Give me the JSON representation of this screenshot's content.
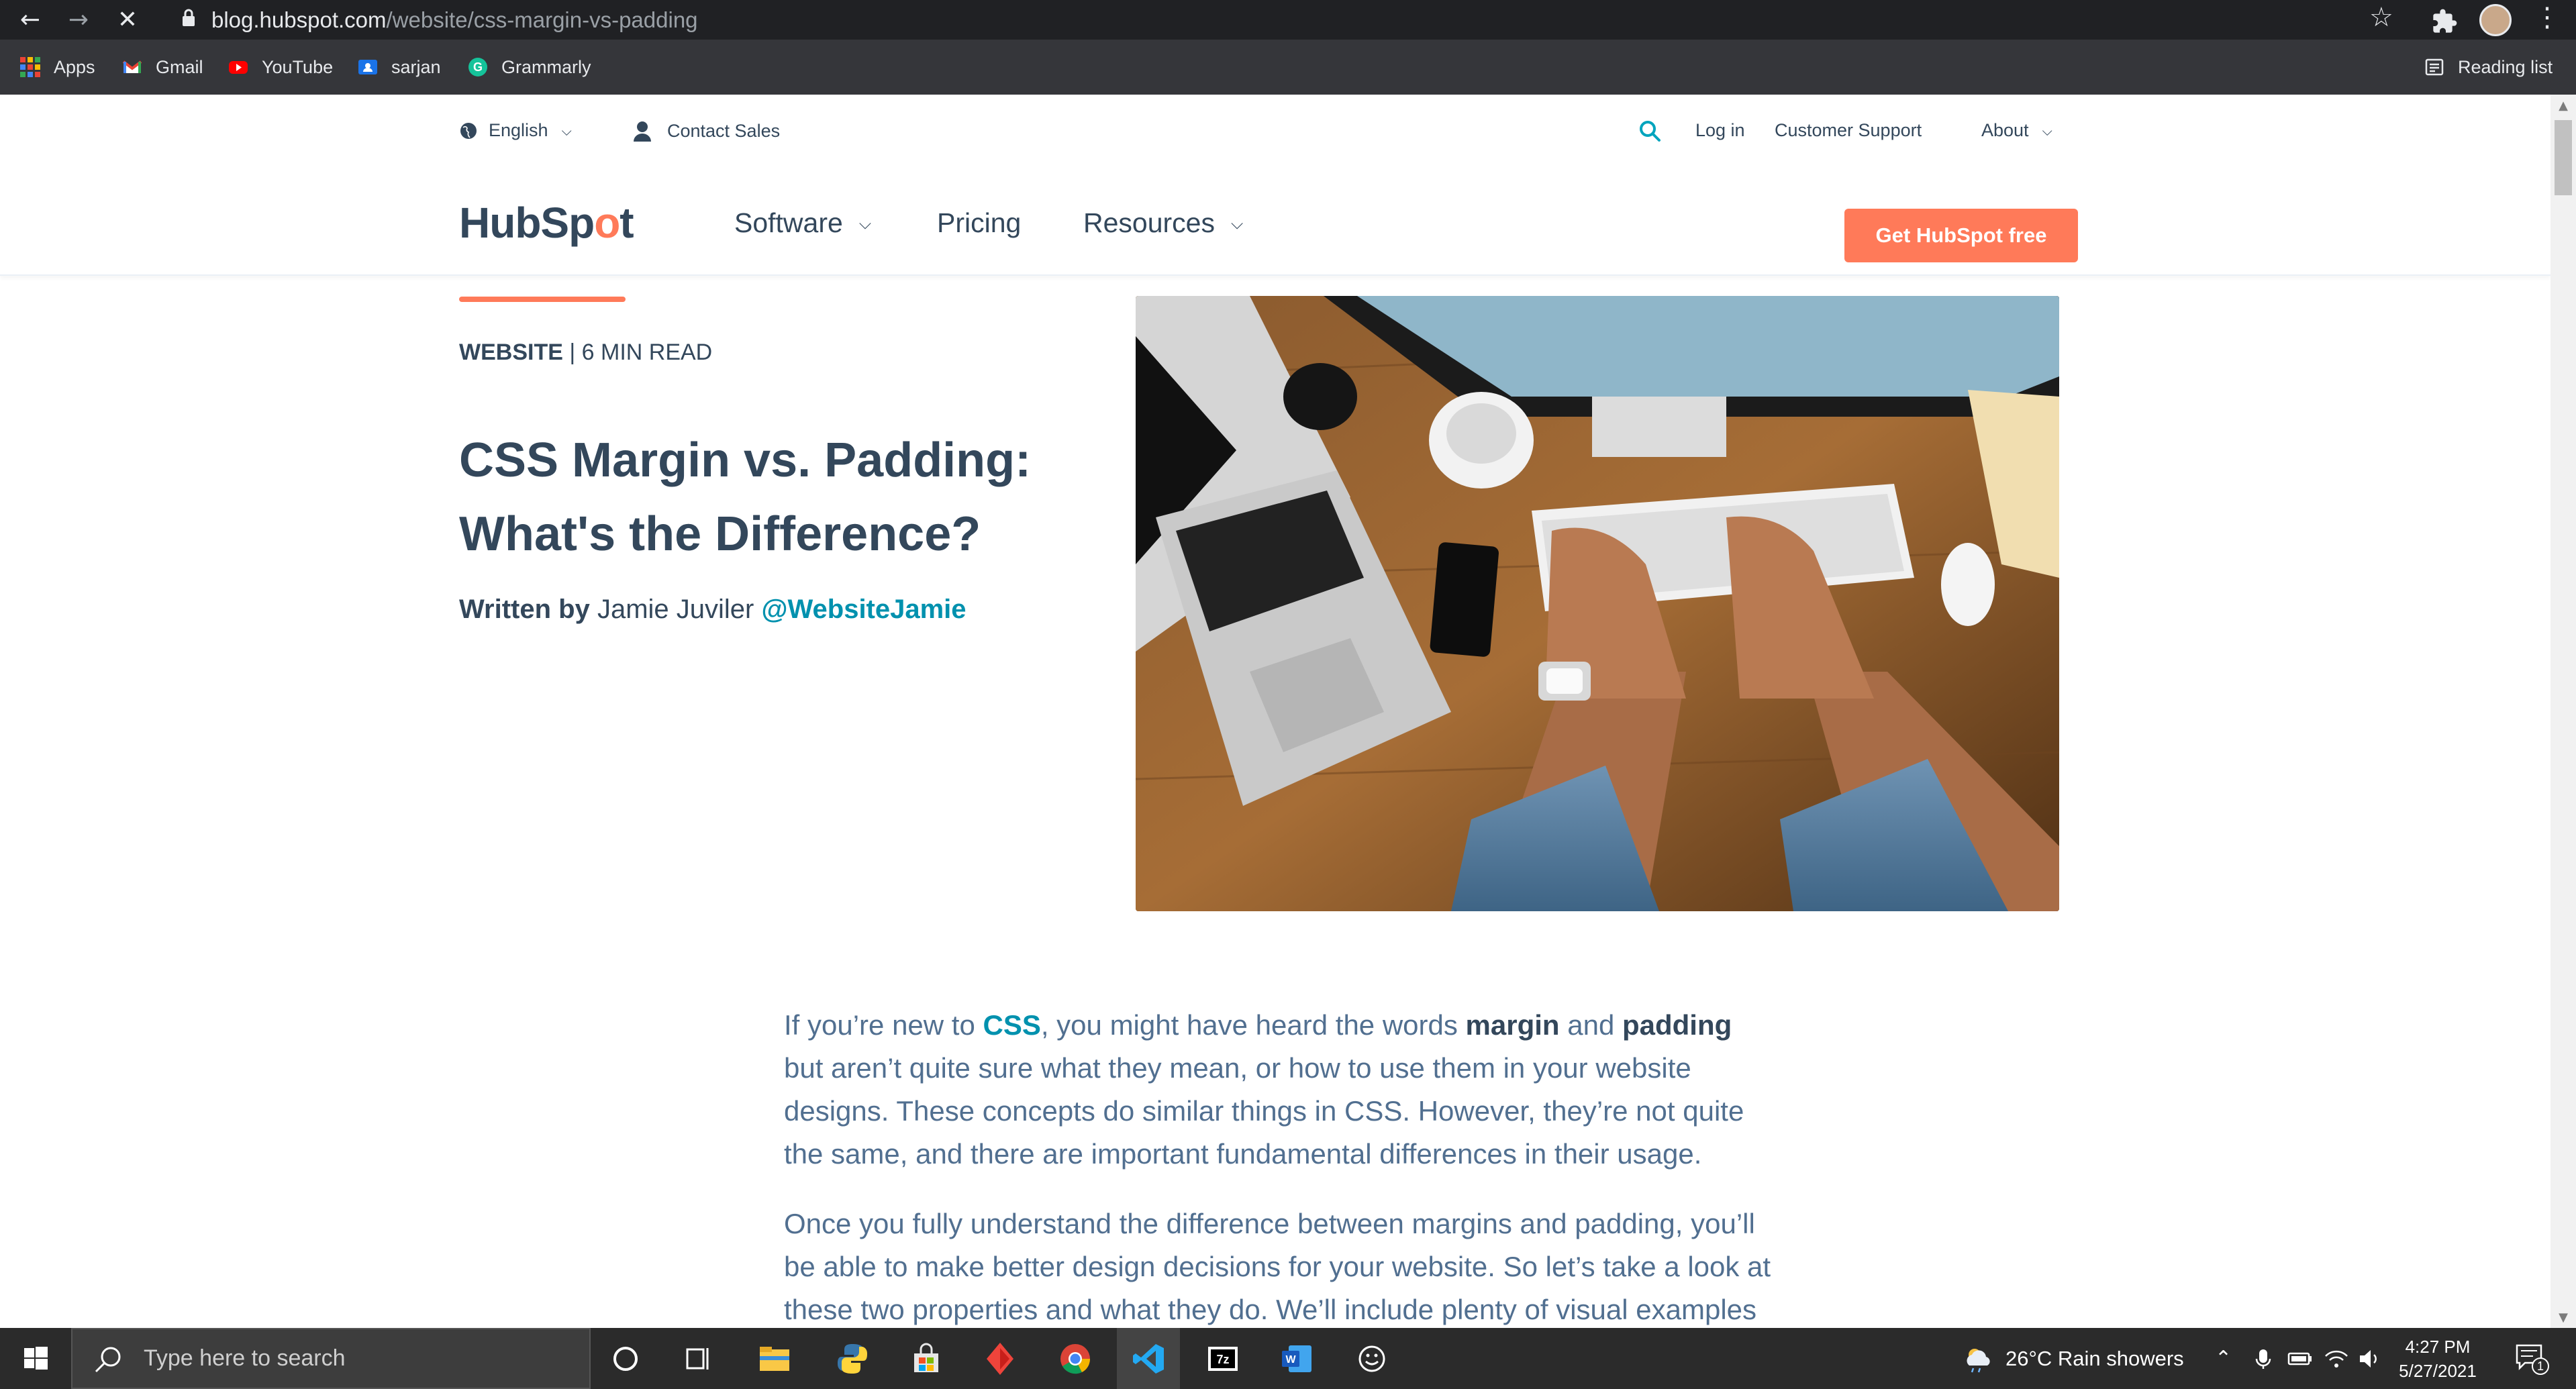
{
  "browser": {
    "url_host": "blog.hubspot.com",
    "url_path": "/website/css-margin-vs-padding",
    "bookmarks": [
      "Apps",
      "Gmail",
      "YouTube",
      "sarjan",
      "Grammarly"
    ],
    "reading_list": "Reading list"
  },
  "utility_nav": {
    "language": "English",
    "contact_sales": "Contact Sales",
    "log_in": "Log in",
    "customer_support": "Customer Support",
    "about": "About"
  },
  "main_nav": {
    "logo_pre": "HubSp",
    "logo_o": "o",
    "logo_post": "t",
    "items": [
      "Software",
      "Pricing",
      "Resources"
    ],
    "cta": "Get HubSpot free"
  },
  "article": {
    "category": "WEBSITE",
    "read_time": "| 6 MIN READ",
    "title": "CSS Margin vs. Padding: What's the Difference?",
    "written_by": "Written by",
    "author": "Jamie Juviler",
    "handle": "@WebsiteJamie",
    "p1_a": "If you’re new to ",
    "p1_link": "CSS",
    "p1_b": ", you might have heard the words ",
    "p1_margin": "margin",
    "p1_c": " and ",
    "p1_padding": "padding",
    "p1_d": " but aren’t quite sure what they mean, or how to use them in your website designs. These concepts do similar things in CSS. However, they’re not quite the same, and there are important fundamental differences in their usage.",
    "p2": "Once you fully understand the difference between margins and padding, you’ll be able to make better design decisions for your website. So let’s take a look at these two properties and what they do. We’ll include plenty of visual examples"
  },
  "taskbar": {
    "search_placeholder": "Type here to search",
    "weather": "26°C  Rain showers",
    "time": "4:27 PM",
    "date": "5/27/2021",
    "notification_count": "1"
  }
}
